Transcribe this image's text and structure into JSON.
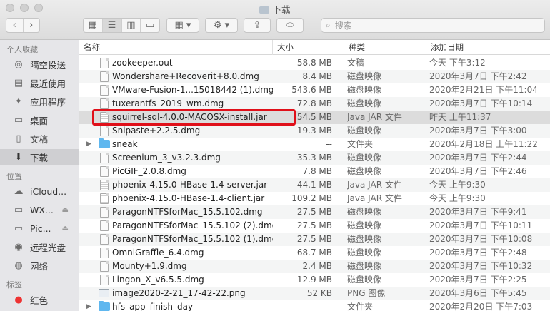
{
  "window": {
    "title": "下载"
  },
  "toolbar": {
    "back_icon": "chevron-left-icon",
    "forward_icon": "chevron-right-icon",
    "search_placeholder": "搜索"
  },
  "sidebar": {
    "sections": [
      {
        "header": "个人收藏",
        "items": [
          {
            "label": "隔空投送",
            "icon": "airdrop-icon"
          },
          {
            "label": "最近使用",
            "icon": "recents-icon"
          },
          {
            "label": "应用程序",
            "icon": "applications-icon"
          },
          {
            "label": "桌面",
            "icon": "desktop-icon"
          },
          {
            "label": "文稿",
            "icon": "documents-icon"
          },
          {
            "label": "下载",
            "icon": "downloads-icon",
            "selected": true
          }
        ]
      },
      {
        "header": "位置",
        "items": [
          {
            "label": "iCloud...",
            "icon": "cloud-icon"
          },
          {
            "label": "WX...",
            "icon": "disk-icon"
          },
          {
            "label": "Pic...",
            "icon": "disk-icon"
          },
          {
            "label": "远程光盘",
            "icon": "optical-disc-icon"
          },
          {
            "label": "网络",
            "icon": "network-icon"
          }
        ]
      },
      {
        "header": "标签",
        "items": [
          {
            "label": "红色",
            "icon": "red-tag-icon"
          }
        ]
      }
    ]
  },
  "columns": {
    "name": "名称",
    "size": "大小",
    "kind": "种类",
    "date": "添加日期"
  },
  "files": [
    {
      "name": "zookeeper.out",
      "size": "58.8 MB",
      "kind": "文稿",
      "date": "今天 下午3:12",
      "type": "doc"
    },
    {
      "name": "Wondershare+Recoverit+8.0.dmg",
      "size": "8.4 MB",
      "kind": "磁盘映像",
      "date": "2020年3月7日 下午2:42",
      "type": "doc"
    },
    {
      "name": "VMware-Fusion-1...15018442 (1).dmg",
      "size": "543.6 MB",
      "kind": "磁盘映像",
      "date": "2020年2月21日 下午11:04",
      "type": "doc"
    },
    {
      "name": "tuxerantfs_2019_wm.dmg",
      "size": "72.8 MB",
      "kind": "磁盘映像",
      "date": "2020年3月7日 下午10:14",
      "type": "doc"
    },
    {
      "name": "squirrel-sql-4.0.0-MACOSX-install.jar",
      "size": "54.5 MB",
      "kind": "Java JAR 文件",
      "date": "昨天 上午11:37",
      "type": "jar",
      "highlight": true
    },
    {
      "name": "Snipaste+2.2.5.dmg",
      "size": "19.3 MB",
      "kind": "磁盘映像",
      "date": "2020年3月7日 下午3:00",
      "type": "doc"
    },
    {
      "name": "sneak",
      "size": "--",
      "kind": "文件夹",
      "date": "2020年2月18日 上午11:22",
      "type": "folder"
    },
    {
      "name": "Screenium_3_v3.2.3.dmg",
      "size": "35.3 MB",
      "kind": "磁盘映像",
      "date": "2020年3月7日 下午2:44",
      "type": "doc"
    },
    {
      "name": "PicGIF_2.0.8.dmg",
      "size": "7.8 MB",
      "kind": "磁盘映像",
      "date": "2020年3月7日 下午2:46",
      "type": "doc"
    },
    {
      "name": "phoenix-4.15.0-HBase-1.4-server.jar",
      "size": "44.1 MB",
      "kind": "Java JAR 文件",
      "date": "今天 上午9:30",
      "type": "jar"
    },
    {
      "name": "phoenix-4.15.0-HBase-1.4-client.jar",
      "size": "109.2 MB",
      "kind": "Java JAR 文件",
      "date": "今天 上午9:30",
      "type": "jar"
    },
    {
      "name": "ParagonNTFSforMac_15.5.102.dmg",
      "size": "27.5 MB",
      "kind": "磁盘映像",
      "date": "2020年3月7日 下午9:41",
      "type": "doc"
    },
    {
      "name": "ParagonNTFSforMac_15.5.102 (2).dmg",
      "size": "27.5 MB",
      "kind": "磁盘映像",
      "date": "2020年3月7日 下午10:11",
      "type": "doc"
    },
    {
      "name": "ParagonNTFSforMac_15.5.102 (1).dmg",
      "size": "27.5 MB",
      "kind": "磁盘映像",
      "date": "2020年3月7日 下午10:08",
      "type": "doc"
    },
    {
      "name": "OmniGraffle_6.4.dmg",
      "size": "68.7 MB",
      "kind": "磁盘映像",
      "date": "2020年3月7日 下午2:48",
      "type": "doc"
    },
    {
      "name": "Mounty+1.9.dmg",
      "size": "2.4 MB",
      "kind": "磁盘映像",
      "date": "2020年3月7日 下午10:32",
      "type": "doc"
    },
    {
      "name": "Lingon_X_v6.5.5.dmg",
      "size": "12.9 MB",
      "kind": "磁盘映像",
      "date": "2020年3月7日 下午2:25",
      "type": "doc"
    },
    {
      "name": "image2020-2-21_17-42-22.png",
      "size": "52 KB",
      "kind": "PNG 图像",
      "date": "2020年3月6日 下午5:45",
      "type": "image"
    },
    {
      "name": "hfs_app_finish_day",
      "size": "--",
      "kind": "文件夹",
      "date": "2020年2月20日 下午7:03",
      "type": "folder"
    }
  ],
  "accent": {
    "highlight_border": "#e0101a",
    "folder": "#5fb7ef"
  }
}
